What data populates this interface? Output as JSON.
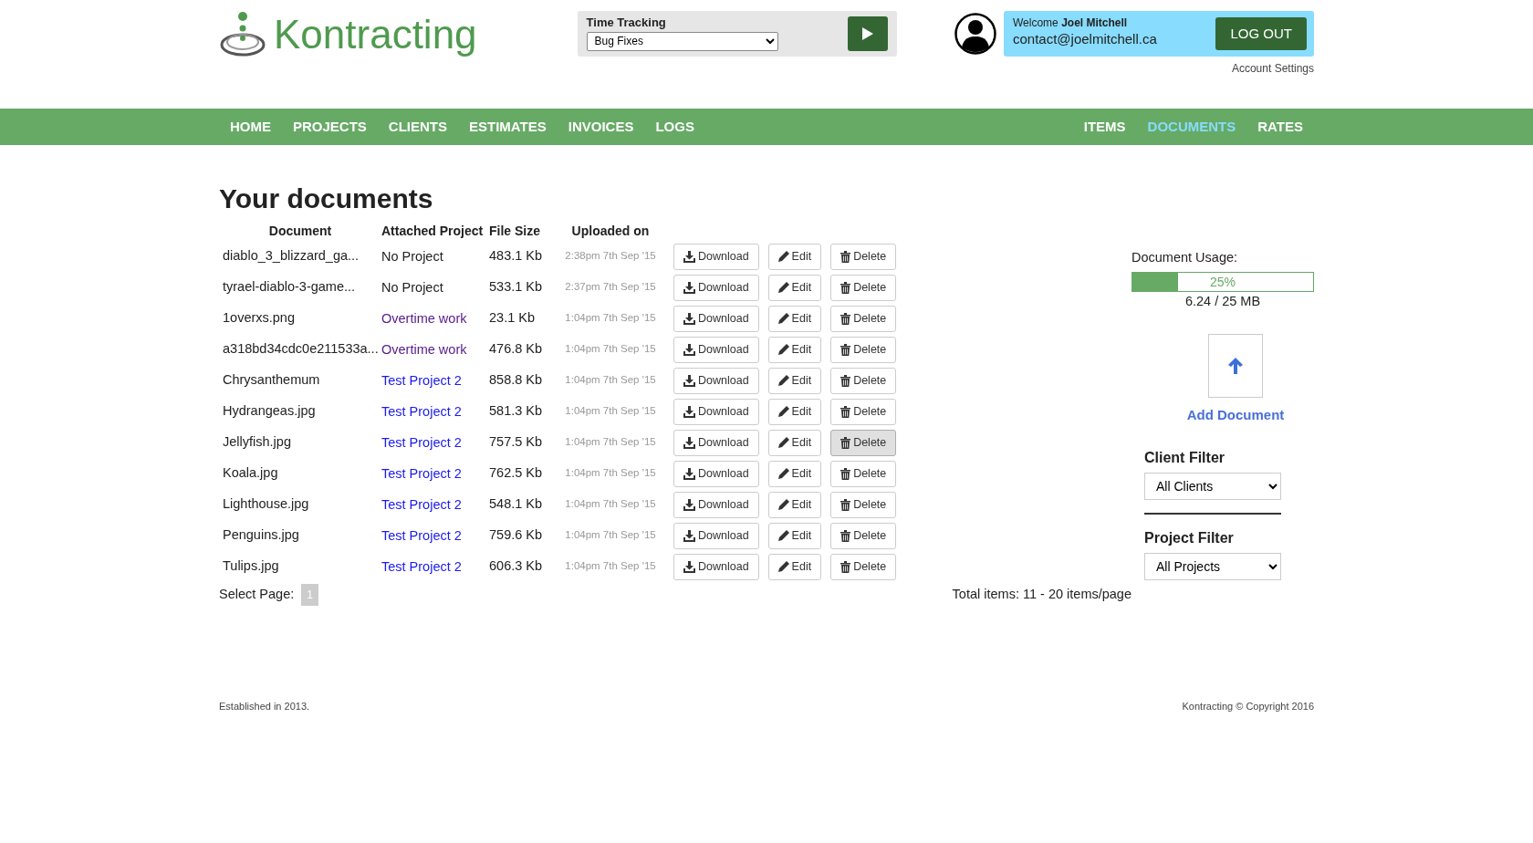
{
  "brand": {
    "name": "Kontracting"
  },
  "time_tracking": {
    "label": "Time Tracking",
    "value": "Bug Fixes"
  },
  "account": {
    "welcome": "Welcome **Joel Mitchell**",
    "email": "contact@joelmitchell.ca",
    "logout": "LOG OUT",
    "settings": "Account Settings"
  },
  "nav_left": [
    {
      "label": "HOME",
      "selected": false
    },
    {
      "label": "PROJECTS",
      "selected": false
    },
    {
      "label": "CLIENTS",
      "selected": false
    },
    {
      "label": "ESTIMATES",
      "selected": false
    },
    {
      "label": "INVOICES",
      "selected": false
    },
    {
      "label": "LOGS",
      "selected": false
    }
  ],
  "nav_right": [
    {
      "label": "ITEMS",
      "selected": false
    },
    {
      "label": "DOCUMENTS",
      "selected": true
    },
    {
      "label": "RATES",
      "selected": false
    }
  ],
  "page_title": "Your documents",
  "table": {
    "columns": [
      "Document",
      "Attached Project",
      "File Size",
      "Uploaded on"
    ],
    "rows": [
      {
        "document": "diablo_3_blizzard_ga...",
        "project": {
          "label": "No Project",
          "color": "#222222"
        },
        "size": "483.1 Kb",
        "uploaded": "2:38pm 7th Sep '15",
        "download": "Download",
        "edit": "Edit",
        "delete": "Delete",
        "delete_hovered": false
      },
      {
        "document": "tyrael-diablo-3-game...",
        "project": {
          "label": "No Project",
          "color": "#222222"
        },
        "size": "533.1 Kb",
        "uploaded": "2:37pm 7th Sep '15",
        "download": "Download",
        "edit": "Edit",
        "delete": "Delete",
        "delete_hovered": false
      },
      {
        "document": "1overxs.png",
        "project": {
          "label": "Overtime work",
          "color": "#551a8b"
        },
        "size": "23.1 Kb",
        "uploaded": "1:04pm 7th Sep '15",
        "download": "Download",
        "edit": "Edit",
        "delete": "Delete",
        "delete_hovered": false
      },
      {
        "document": "a318bd34cdc0e211533a...",
        "project": {
          "label": "Overtime work",
          "color": "#551a8b"
        },
        "size": "476.8 Kb",
        "uploaded": "1:04pm 7th Sep '15",
        "download": "Download",
        "edit": "Edit",
        "delete": "Delete",
        "delete_hovered": false
      },
      {
        "document": "Chrysanthemum",
        "project": {
          "label": "Test Project 2",
          "color": "#1a1aee"
        },
        "size": "858.8 Kb",
        "uploaded": "1:04pm 7th Sep '15",
        "download": "Download",
        "edit": "Edit",
        "delete": "Delete",
        "delete_hovered": false
      },
      {
        "document": "Hydrangeas.jpg",
        "project": {
          "label": "Test Project 2",
          "color": "#1a1aee"
        },
        "size": "581.3 Kb",
        "uploaded": "1:04pm 7th Sep '15",
        "download": "Download",
        "edit": "Edit",
        "delete": "Delete",
        "delete_hovered": false
      },
      {
        "document": "Jellyfish.jpg",
        "project": {
          "label": "Test Project 2",
          "color": "#1a1aee"
        },
        "size": "757.5 Kb",
        "uploaded": "1:04pm 7th Sep '15",
        "download": "Download",
        "edit": "Edit",
        "delete": "Delete",
        "delete_hovered": true
      },
      {
        "document": "Koala.jpg",
        "project": {
          "label": "Test Project 2",
          "color": "#1a1aee"
        },
        "size": "762.5 Kb",
        "uploaded": "1:04pm 7th Sep '15",
        "download": "Download",
        "edit": "Edit",
        "delete": "Delete",
        "delete_hovered": false
      },
      {
        "document": "Lighthouse.jpg",
        "project": {
          "label": "Test Project 2",
          "color": "#1a1aee"
        },
        "size": "548.1 Kb",
        "uploaded": "1:04pm 7th Sep '15",
        "download": "Download",
        "edit": "Edit",
        "delete": "Delete",
        "delete_hovered": false
      },
      {
        "document": "Penguins.jpg",
        "project": {
          "label": "Test Project 2",
          "color": "#1a1aee"
        },
        "size": "759.6 Kb",
        "uploaded": "1:04pm 7th Sep '15",
        "download": "Download",
        "edit": "Edit",
        "delete": "Delete",
        "delete_hovered": false
      },
      {
        "document": "Tulips.jpg",
        "project": {
          "label": "Test Project 2",
          "color": "#1a1aee"
        },
        "size": "606.3 Kb",
        "uploaded": "1:04pm 7th Sep '15",
        "download": "Download",
        "edit": "Edit",
        "delete": "Delete",
        "delete_hovered": false
      }
    ]
  },
  "pagination": {
    "label": "Select Page:",
    "pages": [
      {
        "label": "1",
        "selected": true
      }
    ]
  },
  "total": "Total items: 11 - 20 items/page",
  "usage": {
    "label": "Document Usage:",
    "level": 0.25,
    "percent": "25%",
    "amount": "6.24 / 25 MB"
  },
  "add_document": "Add Document",
  "client_filter": {
    "label": "Client Filter",
    "value": "All Clients"
  },
  "project_filter": {
    "label": "Project Filter",
    "value": "All Projects"
  },
  "footer": {
    "left": "Established in 2013.",
    "right": "Kontracting © Copyright 2016"
  }
}
